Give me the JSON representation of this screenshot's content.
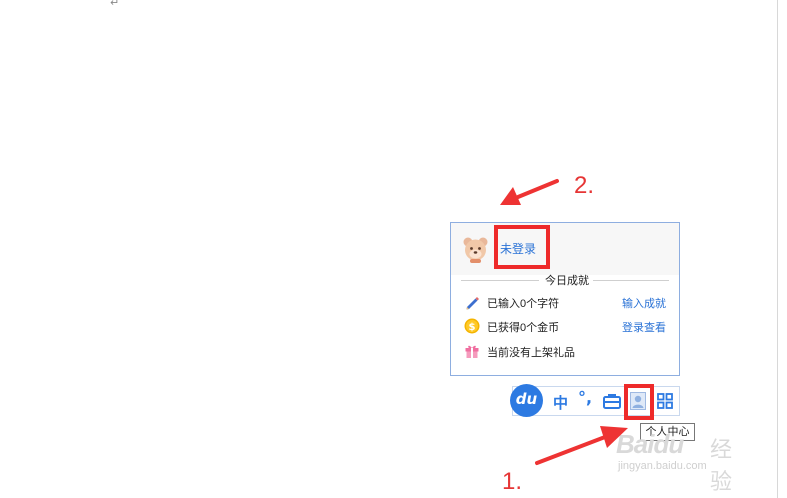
{
  "document": {
    "paragraph_mark": "↵"
  },
  "popup": {
    "login_label": "未登录",
    "section_title": "今日成就",
    "rows": [
      {
        "icon": "pencil-icon",
        "text": "已输入0个字符",
        "link": "输入成就"
      },
      {
        "icon": "coin-icon",
        "text": "已获得0个金币",
        "link": "登录查看"
      },
      {
        "icon": "gift-icon",
        "text": "当前没有上架礼品",
        "link": ""
      }
    ]
  },
  "toolbar": {
    "logo_label": "du",
    "input_mode_label": "中",
    "punctuation_label": "°,",
    "icons": [
      "toolbox-icon",
      "user-center-icon",
      "grid-menu-icon"
    ],
    "tooltip": "个人中心"
  },
  "annotations": {
    "step1": "1.",
    "step2": "2."
  },
  "watermark": {
    "brand": "Baidu",
    "brand_suffix": "经验",
    "url": "jingyan.baidu.com"
  },
  "colors": {
    "accent": "#2d7ae2",
    "link": "#2b73d6",
    "highlight": "#ee2a2a",
    "arrow": "#ee3333"
  }
}
